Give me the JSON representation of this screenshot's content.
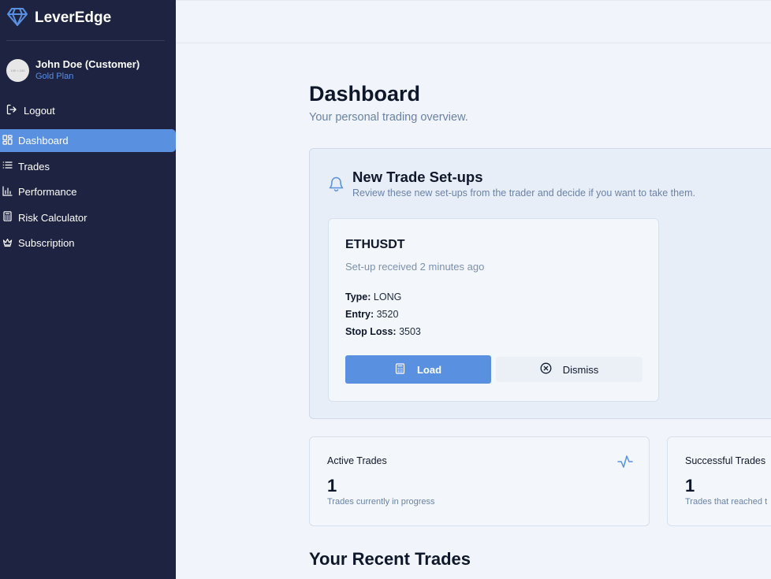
{
  "app": {
    "name": "LeverEdge",
    "logo_icon": "diamond-icon"
  },
  "user": {
    "name": "John Doe (Customer)",
    "plan": "Gold Plan",
    "avatar_text": "100 × 100"
  },
  "sidebar": {
    "logout_label": "Logout",
    "items": [
      {
        "label": "Dashboard",
        "icon": "grid-icon",
        "active": true
      },
      {
        "label": "Trades",
        "icon": "list-icon",
        "active": false
      },
      {
        "label": "Performance",
        "icon": "bar-chart-icon",
        "active": false
      },
      {
        "label": "Risk Calculator",
        "icon": "calculator-icon",
        "active": false
      },
      {
        "label": "Subscription",
        "icon": "crown-icon",
        "active": false
      }
    ]
  },
  "page": {
    "title": "Dashboard",
    "subtitle": "Your personal trading overview."
  },
  "setups": {
    "title": "New Trade Set-ups",
    "description": "Review these new set-ups from the trader and decide if you want to take them.",
    "card": {
      "pair": "ETHUSDT",
      "received": "Set-up received 2 minutes ago",
      "type_label": "Type:",
      "type_value": "LONG",
      "entry_label": "Entry:",
      "entry_value": "3520",
      "stop_label": "Stop Loss:",
      "stop_value": "3503",
      "load_label": "Load",
      "dismiss_label": "Dismiss"
    }
  },
  "stats": [
    {
      "label": "Active Trades",
      "value": "1",
      "note": "Trades currently in progress",
      "icon": "activity-icon"
    },
    {
      "label": "Successful Trades",
      "value": "1",
      "note": "Trades that reached t"
    }
  ],
  "recent": {
    "title": "Your Recent Trades"
  },
  "colors": {
    "sidebar_bg": "#1e2341",
    "accent": "#5a90e0",
    "page_bg": "#f1f5fb"
  }
}
